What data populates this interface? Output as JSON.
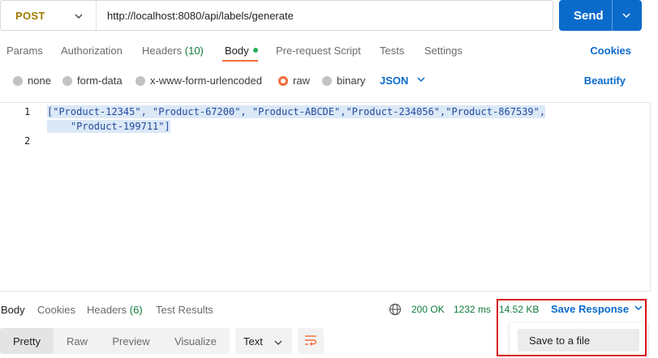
{
  "request": {
    "method": "POST",
    "url": "http://localhost:8080/api/labels/generate",
    "send_label": "Send"
  },
  "request_tabs": {
    "params": "Params",
    "authorization": "Authorization",
    "headers": "Headers",
    "headers_count": "(10)",
    "body": "Body",
    "pre_request": "Pre-request Script",
    "tests": "Tests",
    "settings": "Settings",
    "cookies": "Cookies"
  },
  "body_types": {
    "none": "none",
    "form_data": "form-data",
    "urlencoded": "x-www-form-urlencoded",
    "raw": "raw",
    "binary": "binary",
    "selected_language": "JSON",
    "beautify": "Beautify"
  },
  "editor": {
    "lines": [
      {
        "number": "1",
        "text": "[\"Product-12345\", \"Product-67200\", \"Product-ABCDE\",\"Product-234056\",\"Product-867539\","
      },
      {
        "number": "",
        "text": "    \"Product-199711\"]"
      },
      {
        "number": "2",
        "text": ""
      }
    ]
  },
  "response_tabs": {
    "body": "Body",
    "cookies": "Cookies",
    "headers": "Headers",
    "headers_count": "(6)",
    "test_results": "Test Results"
  },
  "response_meta": {
    "status": "200 OK",
    "time": "1232 ms",
    "size": "14.52 KB",
    "save_response": "Save Response"
  },
  "view_modes": {
    "pretty": "Pretty",
    "raw": "Raw",
    "preview": "Preview",
    "visualize": "Visualize",
    "format": "Text"
  },
  "save_menu": {
    "save_to_file": "Save to a file"
  },
  "colors": {
    "accent_blue": "#0b6bcb",
    "active_orange": "#f26b3a",
    "success_green": "#0f7c3a",
    "method_post": "#a37b00",
    "highlight_red": "#d8121a"
  }
}
